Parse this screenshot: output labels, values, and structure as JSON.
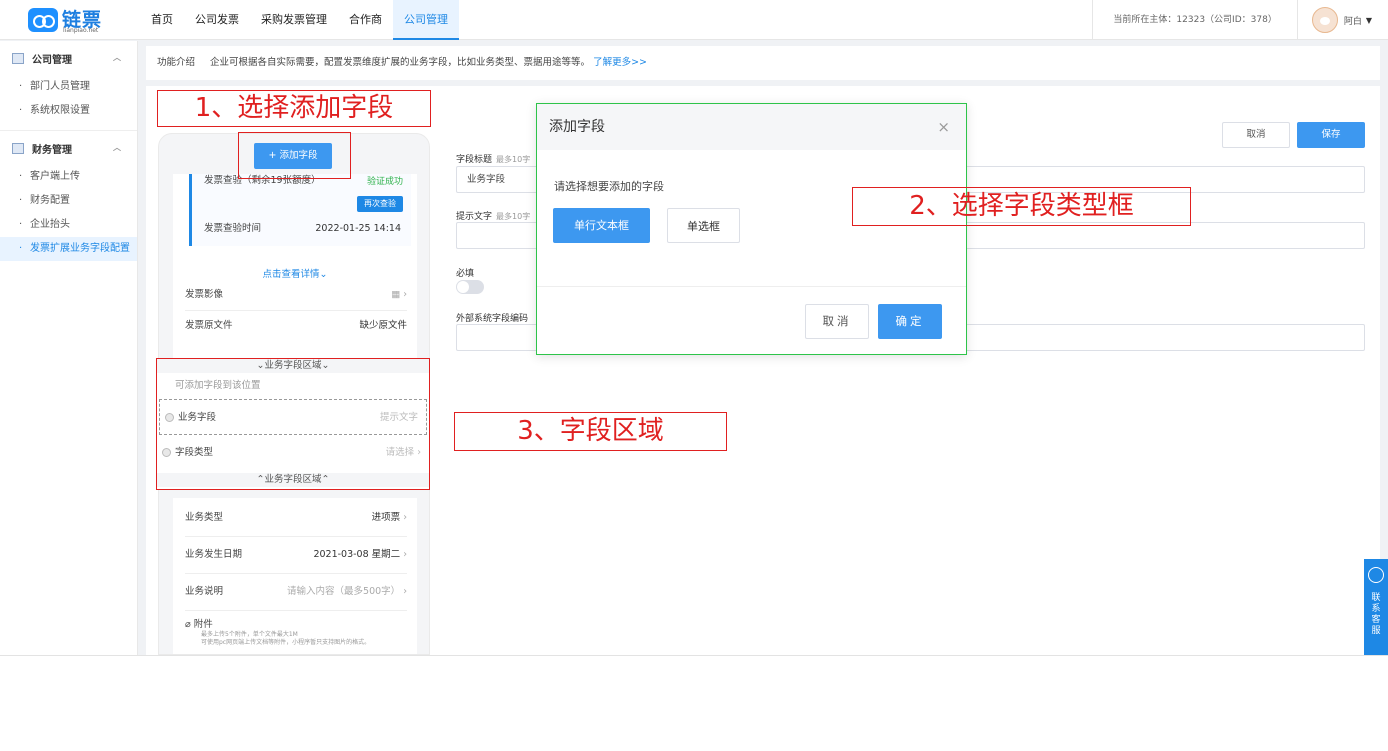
{
  "logo": {
    "text": "链票",
    "sub": "lianpiao.net"
  },
  "nav": [
    "首页",
    "公司发票",
    "采购发票管理",
    "合作商",
    "公司管理"
  ],
  "nav_active": 4,
  "header": {
    "entity": "当前所在主体：12323（公司ID：378）",
    "user": "阿白"
  },
  "sidebar": {
    "group1": "公司管理",
    "group1_items": [
      "部门人员管理",
      "系统权限设置"
    ],
    "group2": "财务管理",
    "group2_items": [
      "客户端上传",
      "财务配置",
      "企业抬头",
      "发票扩展业务字段配置"
    ]
  },
  "intro": {
    "label": "功能介绍",
    "text": "企业可根据各自实际需要，配置发票维度扩展的业务字段，比如业务类型、票据用途等等。",
    "more": "了解更多>>"
  },
  "phone": {
    "add_button": "+ 添加字段",
    "quota": "发票查验（剩余19张额度）",
    "verify_status": "验证成功",
    "recheck": "再次查验",
    "verify_time_label": "发票查验时间",
    "verify_time": "2022-01-25 14:14",
    "detail_link": "点击查看详情⌄",
    "image_label": "发票影像",
    "original_label": "发票原文件",
    "original_value": "缺少原文件",
    "zone_head_top": "⌄业务字段区域⌄",
    "zone_hint": "可添加字段到该位置",
    "field1_label": "业务字段",
    "field1_hint": "提示文字",
    "field2_label": "字段类型",
    "field2_value": "请选择",
    "zone_head_bottom": "⌃业务字段区域⌃",
    "biz_type_label": "业务类型",
    "biz_type_value": "进项票",
    "biz_date_label": "业务发生日期",
    "biz_date_value": "2021-03-08  星期二",
    "biz_desc_label": "业务说明",
    "biz_desc_value": "请输入内容（最多500字）",
    "attach_label": "附件",
    "attach_note": "最多上传5个附件，单个文件最大1M",
    "attach_note2": "可使用pc网页端上传文档等附件，小程序暂只支持图片的格式。"
  },
  "form": {
    "title_label": "字段标题",
    "title_sub": "最多10字",
    "title_value": "业务字段",
    "hint_label": "提示文字",
    "hint_sub": "最多10字",
    "required_label": "必填",
    "code_label": "外部系统字段编码",
    "cancel": "取消",
    "save": "保存"
  },
  "modal": {
    "title": "添加字段",
    "close": "×",
    "question": "请选择想要添加的字段",
    "option1": "单行文本框",
    "option2": "单选框",
    "cancel": "取消",
    "ok": "确定"
  },
  "annotations": [
    "1、选择添加字段",
    "2、选择字段类型框",
    "3、字段区域"
  ],
  "service": [
    "联",
    "系",
    "客",
    "服"
  ],
  "colors": {
    "primary": "#3d98f0",
    "annotation": "#e02020",
    "modal_border": "#2ec44a",
    "success": "#2fb24c"
  }
}
